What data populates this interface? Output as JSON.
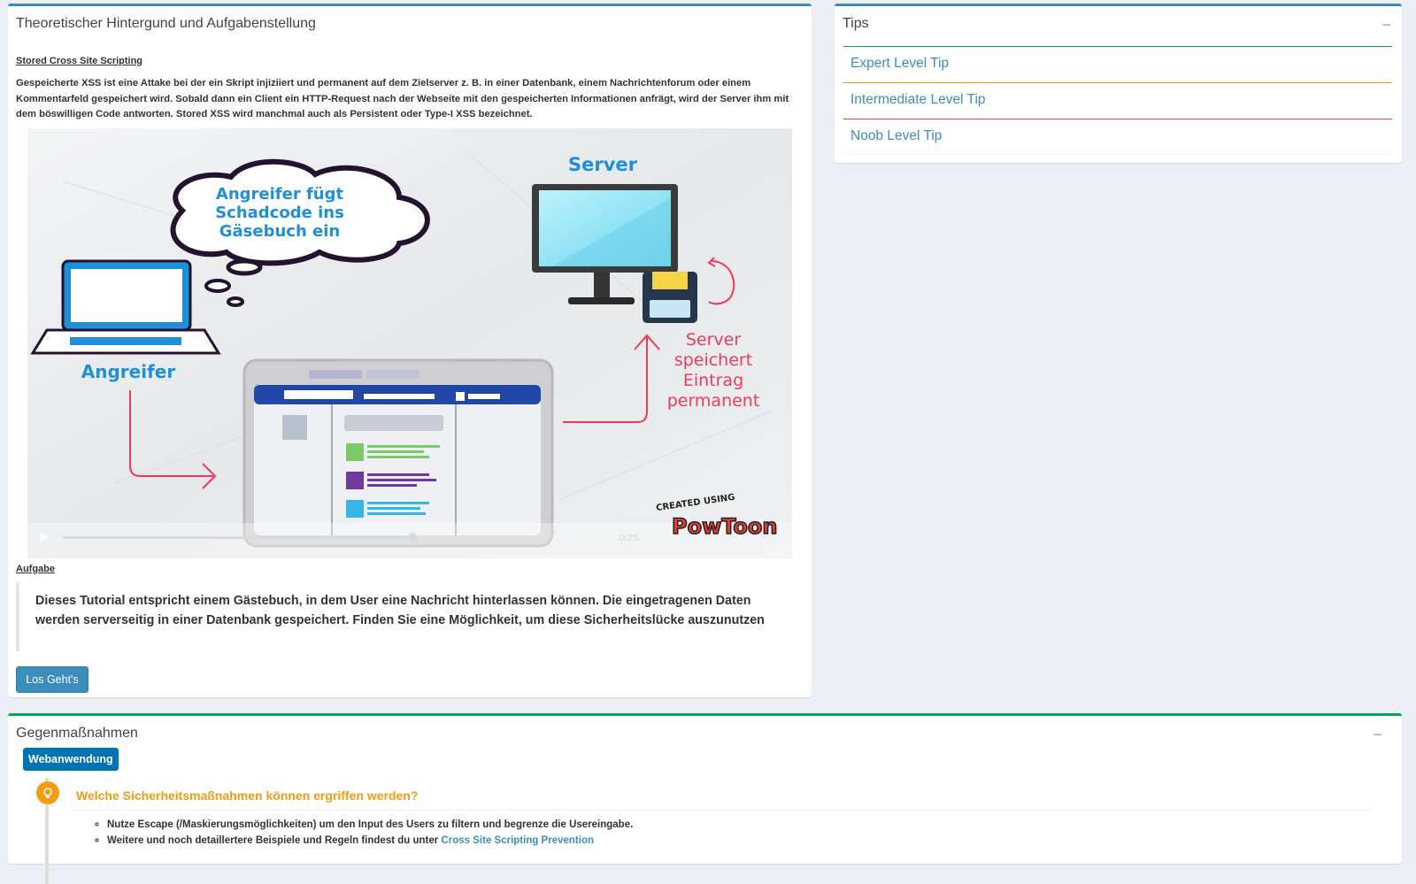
{
  "theory": {
    "title": "Theoretischer Hintergund und Aufgabenstellung",
    "subtitle": "Stored Cross Site Scripting",
    "intro": "Gespeicherte XSS ist eine Attake bei der ein Skript injiziiert und permanent auf dem Zielserver z. B. in einer Datenbank, einem Nachrichtenforum oder einem Kommentarfeld gespeichert wird. Sobald dann ein Client ein HTTP-Request nach der Webseite mit den gespeicherten Informationen anfrägt, wird der Server ihm mit dem böswilligen Code antworten. Stored XSS wird manchmal auch als Persistent oder Type-I XSS bezeichnet.",
    "video": {
      "cloud_text": [
        "Angreifer fügt",
        "Schadcode ins",
        "Gäsebuch ein"
      ],
      "server_label": "Server",
      "attacker_label": "Angreifer",
      "server_stores": [
        "Server",
        "speichert",
        "Eintrag",
        "permanent"
      ],
      "watermark_top": "CREATED USING",
      "watermark_brand": "PowToon",
      "time": "0:25"
    },
    "task_heading": "Aufgabe",
    "task_text": "Dieses Tutorial entspricht einem Gästebuch, in dem User eine Nachricht hinterlassen können. Die eingetragenen Daten werden serverseitig in einer Datenbank gespeichert. Finden Sie eine Möglichkeit, um diese Sicherheitslücke auszunutzen",
    "button": "Los Geht's"
  },
  "tips": {
    "title": "Tips",
    "collapse": "−",
    "items": [
      {
        "label": "Expert Level Tip",
        "color": "#00a65a"
      },
      {
        "label": "Intermediate Level Tip",
        "color": "#f39c12"
      },
      {
        "label": "Noob Level Tip",
        "color": "#dd4b39"
      }
    ]
  },
  "counter": {
    "title": "Gegenmaßnahmen",
    "collapse": "−",
    "badge": "Webanwendung",
    "question": "Welche Sicherheitsmaßnahmen können ergriffen werden?",
    "bullet1": "Nutze Escape (/Maskierungsmöglichkeiten) um den Input des Users zu filtern und begrenze die Usereingabe.",
    "bullet2_prefix": "Weitere und noch detaillertere Beispiele und Regeln findest du unter",
    "bullet2_link": "Cross Site Scripting Prevention"
  }
}
